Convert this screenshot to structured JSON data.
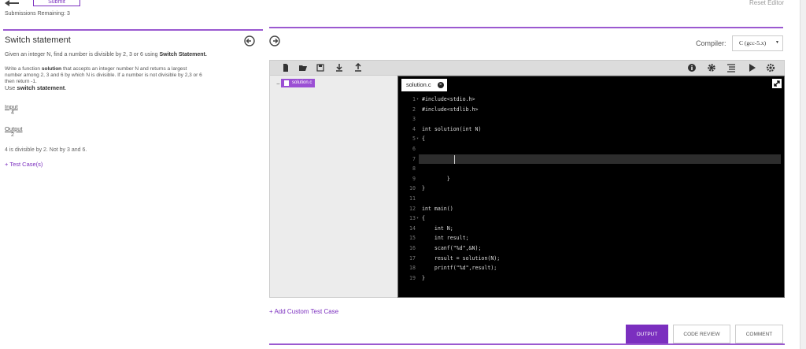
{
  "header": {
    "submit_label": "Submit",
    "submissions_remaining": "Submissions Remaining: 3",
    "reset_label": "Reset Editor"
  },
  "problem": {
    "title": "Switch statement",
    "summary_prefix": "Given an integer N, find a number is divisible by 2, 3 or 6 using ",
    "summary_bold": "Switch Statement.",
    "body_1": "Write a function ",
    "body_bold": "solution",
    "body_2": " that accepts an integer number N and returns a largest",
    "body_3": "number among 2, 3 and 6 by which N is divisible. If a number is not divisible by 2,3 or 6",
    "body_4": "then return -1.",
    "use_prefix": "Use ",
    "use_bold": "switch statement",
    "use_suffix": ".",
    "input_label": "Input",
    "input_value": "4",
    "output_label": "Output",
    "output_value": "2",
    "explanation": "4 is divisible by 2. Not by 3 and 6.",
    "test_cases": "+ Test Case(s)"
  },
  "compiler": {
    "label": "Compiler:",
    "selected": "C (gcc-5.x)"
  },
  "file_tree": {
    "toggle": "−",
    "file": "solution.c"
  },
  "editor": {
    "tab_label": "solution.c",
    "lines": [
      {
        "n": "1",
        "fold": "▾",
        "code": "#include<stdio.h>"
      },
      {
        "n": "2",
        "fold": "",
        "code": "#include<stdlib.h>"
      },
      {
        "n": "3",
        "fold": "",
        "code": ""
      },
      {
        "n": "4",
        "fold": "",
        "code": "int solution(int N)"
      },
      {
        "n": "5",
        "fold": "▾",
        "code": "{"
      },
      {
        "n": "6",
        "fold": "",
        "code": ""
      },
      {
        "n": "7",
        "fold": "",
        "code": ""
      },
      {
        "n": "8",
        "fold": "",
        "code": ""
      },
      {
        "n": "9",
        "fold": "",
        "code": "        }"
      },
      {
        "n": "10",
        "fold": "",
        "code": "}"
      },
      {
        "n": "11",
        "fold": "",
        "code": ""
      },
      {
        "n": "12",
        "fold": "",
        "code": "int main()"
      },
      {
        "n": "13",
        "fold": "▾",
        "code": "{"
      },
      {
        "n": "14",
        "fold": "",
        "code": "    int N;"
      },
      {
        "n": "15",
        "fold": "",
        "code": "    int result;"
      },
      {
        "n": "16",
        "fold": "",
        "code": "    scanf(\"%d\",&N);"
      },
      {
        "n": "17",
        "fold": "",
        "code": "    result = solution(N);"
      },
      {
        "n": "18",
        "fold": "",
        "code": "    printf(\"%d\",result);"
      },
      {
        "n": "19",
        "fold": "",
        "code": "}"
      }
    ]
  },
  "add_custom": "+ Add Custom Test Case",
  "bottom_tabs": {
    "output": "OUTPUT",
    "code_review": "CODE REVIEW",
    "comment": "COMMENT"
  },
  "colors": {
    "accent": "#7b2fbf"
  }
}
